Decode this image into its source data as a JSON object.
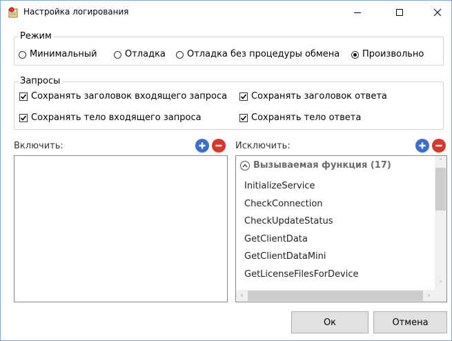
{
  "window": {
    "title": "Настройка логирования"
  },
  "mode": {
    "legend": "Режим",
    "options": [
      {
        "label": "Минимальный",
        "selected": false
      },
      {
        "label": "Отладка",
        "selected": false
      },
      {
        "label": "Отладка без процедуры обмена",
        "selected": false
      },
      {
        "label": "Произвольно",
        "selected": true
      }
    ]
  },
  "requests": {
    "legend": "Запросы",
    "checkboxes": [
      {
        "label": "Сохранять заголовок входящего запроса",
        "checked": true
      },
      {
        "label": "Сохранять заголовок ответа",
        "checked": true
      },
      {
        "label": "Сохранять тело входящего запроса",
        "checked": true
      },
      {
        "label": "Сохранять тело ответа",
        "checked": true
      }
    ]
  },
  "include": {
    "label": "Включить:",
    "items": []
  },
  "exclude": {
    "label": "Исключить:",
    "group_header": "Вызываемая функция (17)",
    "items": [
      "InitializeService",
      "CheckConnection",
      "CheckUpdateStatus",
      "GetClientData",
      "GetClientDataMini",
      "GetLicenseFilesForDevice"
    ]
  },
  "buttons": {
    "ok": "Ок",
    "cancel": "Отмена"
  },
  "colors": {
    "plus": "#3b6fc9",
    "minus": "#d6382c",
    "window_border": "#7aa6d6"
  }
}
